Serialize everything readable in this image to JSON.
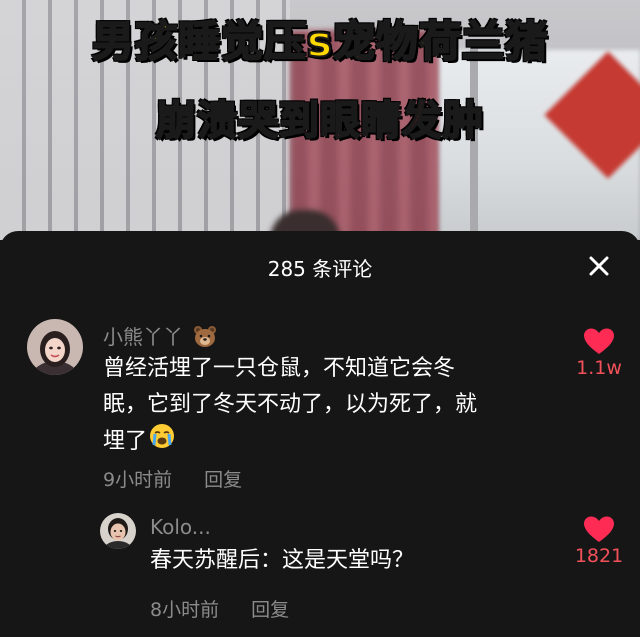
{
  "video": {
    "title_line1": "男孩睡觉压s宠物荷兰猪",
    "title_line2": "崩溃哭到眼睛发肿"
  },
  "comments_panel": {
    "count_label": "285 条评论",
    "close_icon": "close-icon"
  },
  "comments": [
    {
      "username": "小熊丫丫",
      "username_emoji": "bear-face-emoji",
      "text_line1": "曾经活埋了一只仓鼠，不知道它会冬",
      "text_line2": "眠，它到了冬天不动了，以为死了，就",
      "text_line3": "埋了",
      "text_emoji": "loudly-crying-face-emoji",
      "time": "9小时前",
      "reply_label": "回复",
      "likes": "1.1w",
      "like_icon": "heart-icon",
      "like_color": "#fe2c55"
    },
    {
      "username": "Kolo...",
      "text_line1": "春天苏醒后：这是天堂吗？",
      "time": "8小时前",
      "reply_label": "回复",
      "likes": "1821",
      "like_icon": "heart-icon",
      "like_color": "#fe2c55"
    }
  ]
}
